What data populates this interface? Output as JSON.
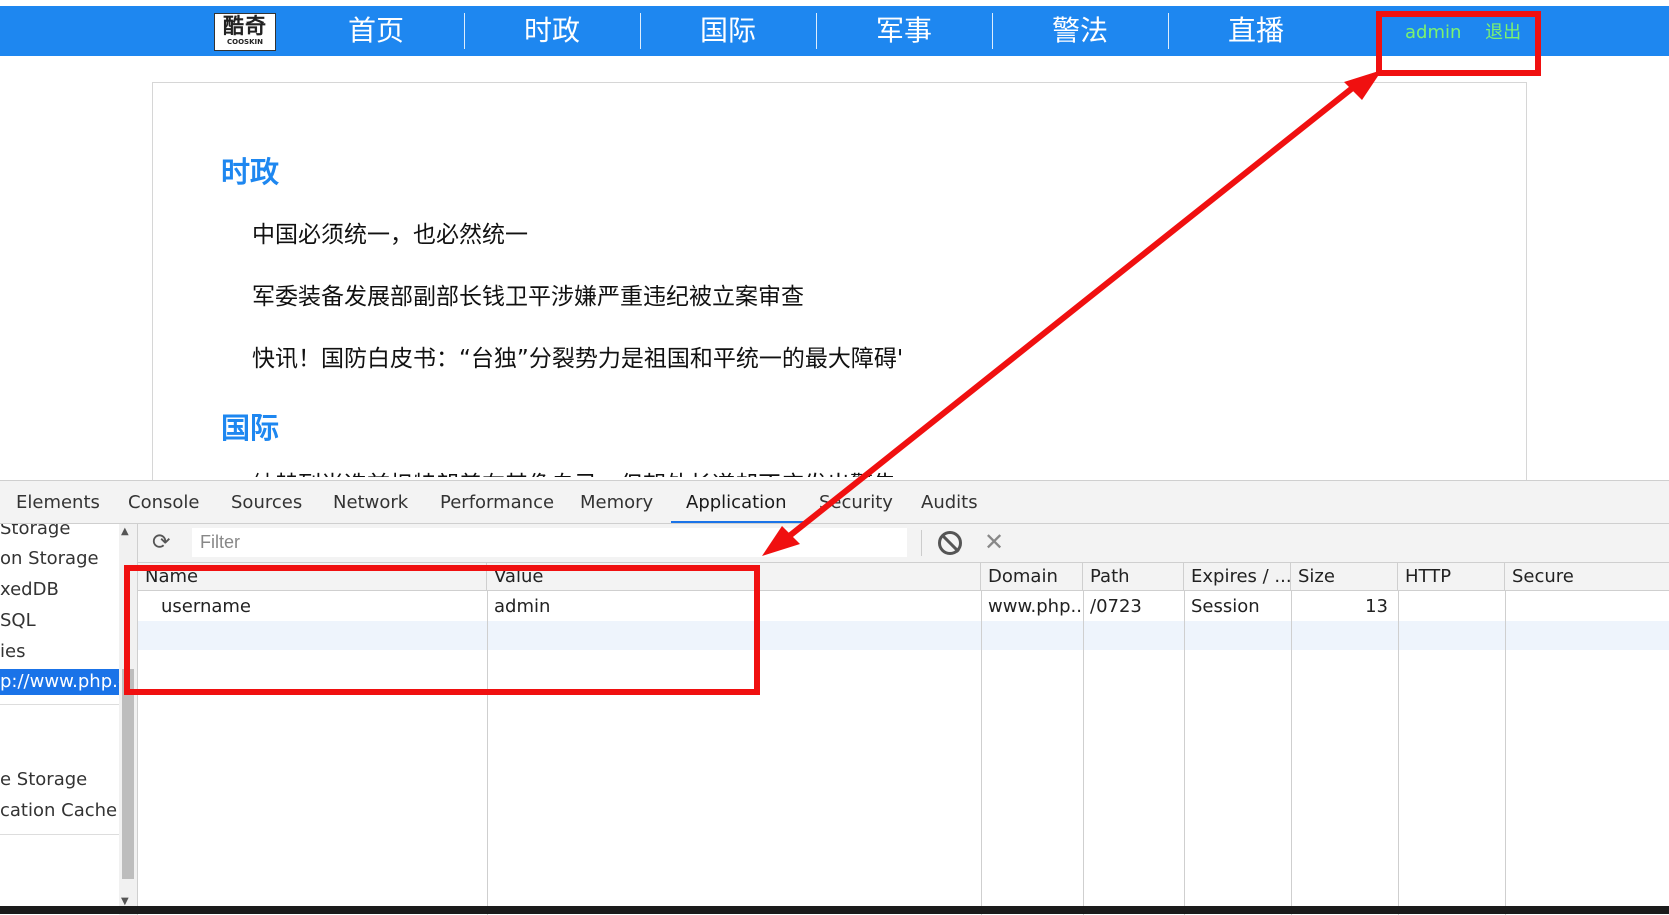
{
  "site": {
    "logo": {
      "text": "酷奇",
      "sub": "COOSKIN"
    },
    "nav": [
      "首页",
      "时政",
      "国际",
      "军事",
      "警法",
      "直播"
    ],
    "user": {
      "name": "admin",
      "logout": "退出"
    }
  },
  "content": {
    "sections": [
      {
        "title": "时政",
        "items": [
          "中国必须统一，也必然统一",
          "军委装备发展部副部长钱卫平涉嫌严重违纪被立案审查",
          "快讯！国防白皮书：“台独”分裂势力是祖国和平统一的最大障碍'"
        ]
      },
      {
        "title": "国际",
        "items": [
          "纳赫列尚选前担特朗普在其像自己，但朝外长道却不应发出警告"
        ]
      }
    ]
  },
  "devtools": {
    "tabs": [
      "Elements",
      "Console",
      "Sources",
      "Network",
      "Performance",
      "Memory",
      "Application",
      "Security",
      "Audits"
    ],
    "active_tab": "Application",
    "sidebar": {
      "items": [
        "Storage",
        "on Storage",
        "xedDB",
        "SQL",
        "ies",
        "p://www.php.c",
        "e Storage",
        "cation Cache"
      ],
      "selected": "p://www.php.c"
    },
    "filter_placeholder": "Filter",
    "columns": [
      "Name",
      "Value",
      "Domain",
      "Path",
      "Expires / ...",
      "Size",
      "HTTP",
      "Secure"
    ],
    "rows": [
      {
        "name": "username",
        "value": "admin",
        "domain": "www.php...",
        "path": "/0723",
        "expires": "Session",
        "size": "13",
        "http": "",
        "secure": ""
      }
    ]
  },
  "colors": {
    "nav": "#1e87f0",
    "username": "#7cf26e",
    "annotation": "#f01010",
    "selection": "#1a73e8"
  },
  "icons": [
    "refresh-icon",
    "clear-all-icon",
    "delete-icon"
  ]
}
